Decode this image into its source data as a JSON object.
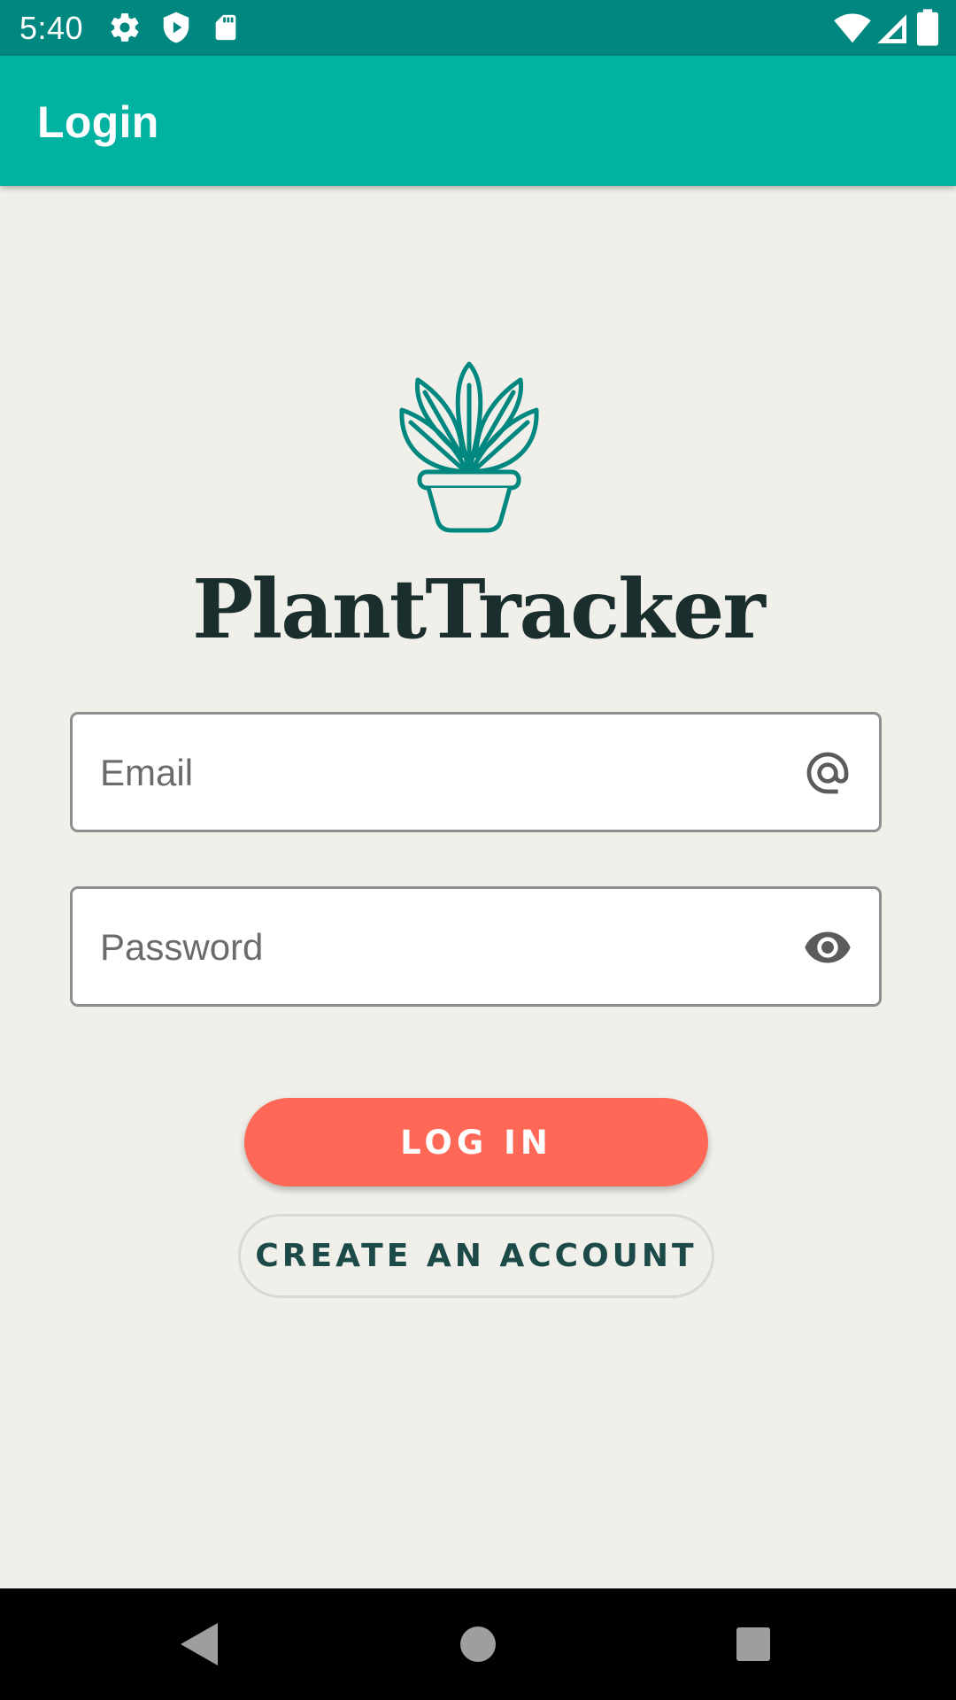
{
  "status_bar": {
    "time": "5:40",
    "left_icons": [
      "gear-icon",
      "shield-play-icon",
      "sd-card-icon"
    ],
    "right_icons": [
      "wifi-icon",
      "cell-signal-icon",
      "battery-icon"
    ]
  },
  "app_bar": {
    "title": "Login"
  },
  "brand": {
    "name": "PlantTracker",
    "logo": "plant-pot-icon",
    "logo_color": "#00877f"
  },
  "form": {
    "email": {
      "placeholder": "Email",
      "value": "",
      "icon": "at-sign-icon"
    },
    "password": {
      "placeholder": "Password",
      "value": "",
      "icon": "eye-icon"
    }
  },
  "buttons": {
    "login": "LOG IN",
    "create_account": "CREATE AN ACCOUNT"
  },
  "colors": {
    "status_bar": "#00877f",
    "app_bar": "#00b2a2",
    "background": "#f1efe9",
    "primary_button": "#ff6756",
    "brand_text": "#1a2e2d"
  },
  "nav_bar": {
    "buttons": [
      "back-icon",
      "home-icon",
      "recents-icon"
    ]
  }
}
